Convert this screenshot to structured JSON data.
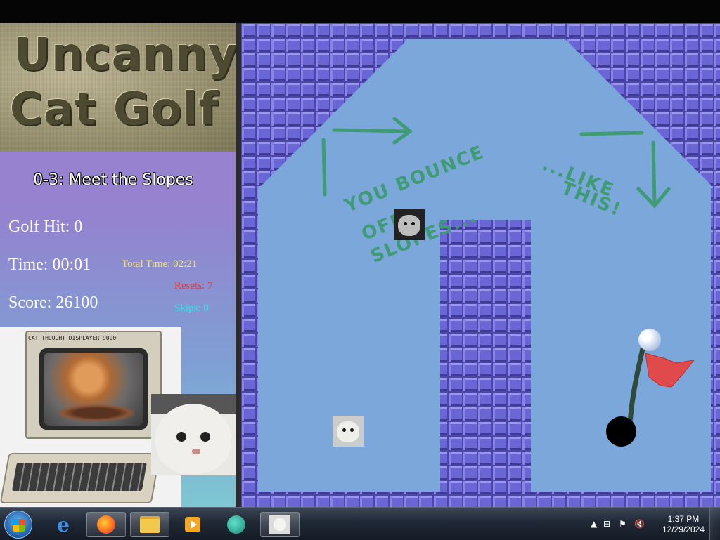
{
  "game": {
    "logo_line1": "Uncanny",
    "logo_line2": "Cat Golf",
    "level_title": "0-3: Meet the Slopes",
    "golf_hit": "Golf Hit: 0",
    "time": "Time: 00:01",
    "total_time": "Total Time: 02:21",
    "resets": "Resets: 7",
    "skips": "Skips: 0",
    "score": "Score: 26100",
    "monitor_label": "CAT THOUGHT DISPLAYER 9000",
    "scribble": [
      "YOU BOUNCE",
      "OFF",
      "SLOPES...",
      "...LIKE",
      "THIS!"
    ],
    "colors": {
      "brick": "#6a66d6",
      "sky": "#7ba7db",
      "arrow": "#3f9b74",
      "flag": "#e04a4a"
    }
  },
  "taskbar": {
    "items": [
      "start-icon",
      "internet-explorer-icon",
      "firefox-icon",
      "file-explorer-icon",
      "media-player-icon",
      "app-icon",
      "cat-golf-icon"
    ],
    "time": "1:37 PM",
    "date": "12/29/2024"
  }
}
